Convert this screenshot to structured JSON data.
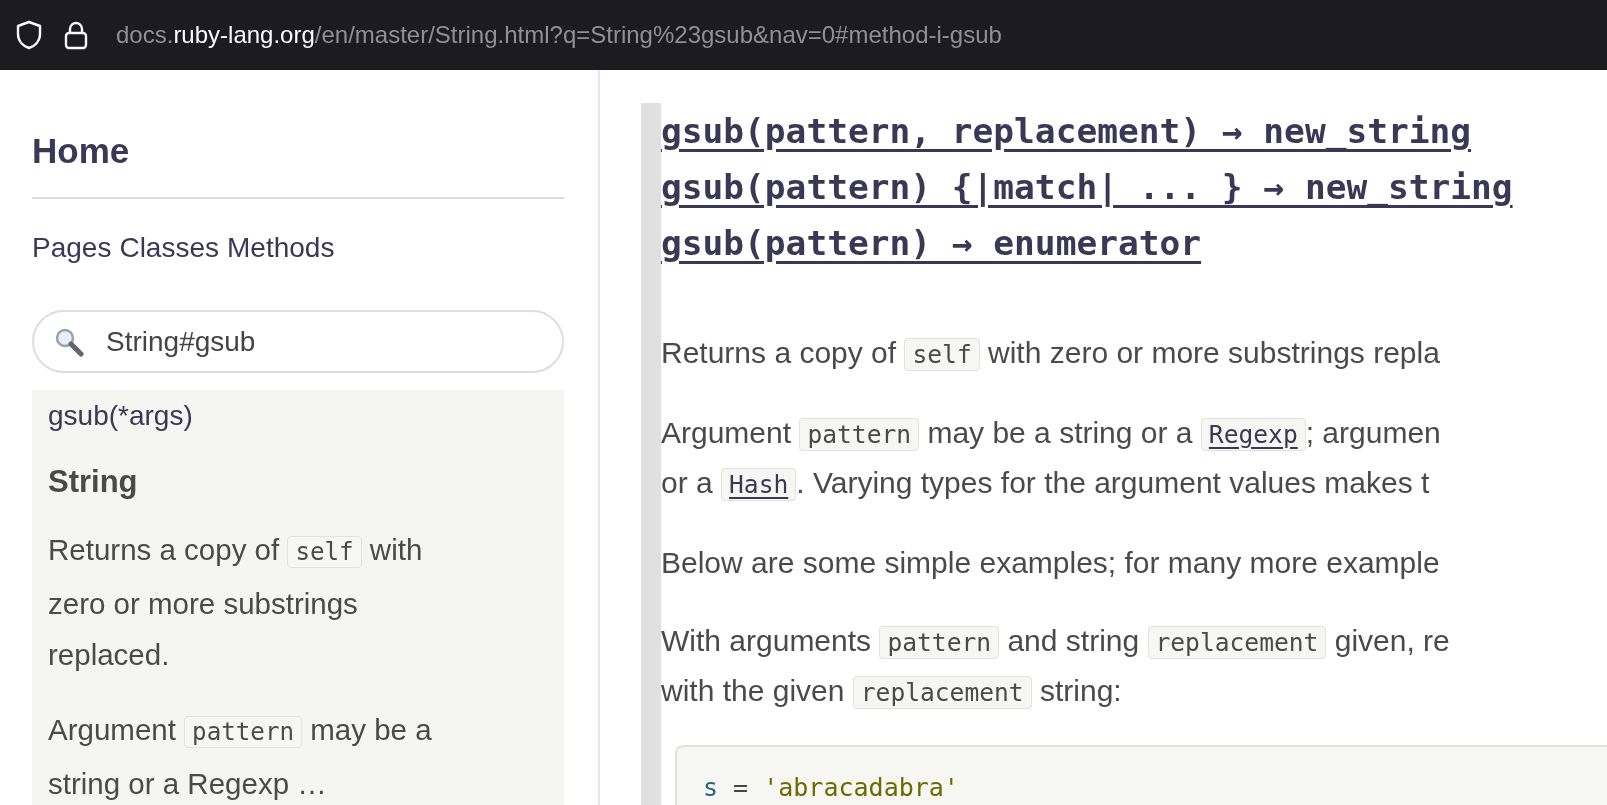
{
  "browser": {
    "url": {
      "prefix": "docs.",
      "domain": "ruby-lang.org",
      "path": "/en/master/String.html?q=String%23gsub&nav=0#method-i-gsub"
    }
  },
  "sidebar": {
    "home": "Home",
    "nav_links": [
      "Pages",
      "Classes",
      "Methods"
    ],
    "search": {
      "value": "String#gsub"
    },
    "result": {
      "method": "gsub(*args)",
      "class": "String",
      "paragraphs": [
        [
          [
            {
              "kind": "text",
              "text": "Returns a copy of "
            },
            {
              "kind": "code",
              "text": "self"
            },
            {
              "kind": "text",
              "text": " with"
            }
          ],
          [
            {
              "kind": "text",
              "text": "zero or more substrings"
            }
          ],
          [
            {
              "kind": "text",
              "text": "replaced."
            }
          ]
        ],
        [
          [
            {
              "kind": "text",
              "text": "Argument "
            },
            {
              "kind": "code",
              "text": "pattern"
            },
            {
              "kind": "text",
              "text": " may be a"
            }
          ],
          [
            {
              "kind": "text",
              "text": "string or a Regexp …"
            }
          ]
        ]
      ]
    }
  },
  "main": {
    "signatures": [
      "gsub(pattern, replacement) → new_string",
      "gsub(pattern) {|match| ... } → new_string",
      "gsub(pattern) → enumerator"
    ],
    "paragraphs": [
      [
        [
          {
            "kind": "text",
            "text": "Returns a copy of "
          },
          {
            "kind": "code",
            "text": "self"
          },
          {
            "kind": "text",
            "text": " with zero or more substrings repla"
          }
        ]
      ],
      [
        [
          {
            "kind": "text",
            "text": "Argument "
          },
          {
            "kind": "code",
            "text": "pattern"
          },
          {
            "kind": "text",
            "text": " may be a string or a "
          },
          {
            "kind": "link",
            "text": "Regexp"
          },
          {
            "kind": "text",
            "text": "; argumen"
          }
        ],
        [
          {
            "kind": "text",
            "text": "or a "
          },
          {
            "kind": "link",
            "text": "Hash"
          },
          {
            "kind": "text",
            "text": ". Varying types for the argument values makes t"
          }
        ]
      ],
      [
        [
          {
            "kind": "text",
            "text": "Below are some simple examples; for many more example"
          }
        ]
      ],
      [
        [
          {
            "kind": "text",
            "text": "With arguments "
          },
          {
            "kind": "code",
            "text": "pattern"
          },
          {
            "kind": "text",
            "text": " and string "
          },
          {
            "kind": "code",
            "text": "replacement"
          },
          {
            "kind": "text",
            "text": " given, re"
          }
        ],
        [
          {
            "kind": "text",
            "text": "with the given "
          },
          {
            "kind": "code",
            "text": "replacement"
          },
          {
            "kind": "text",
            "text": " string:"
          }
        ]
      ]
    ],
    "code_block": [
      {
        "kind": "variable",
        "text": "s"
      },
      {
        "kind": "plain",
        "text": " = "
      },
      {
        "kind": "string",
        "text": "'abracadabra'"
      }
    ]
  }
}
